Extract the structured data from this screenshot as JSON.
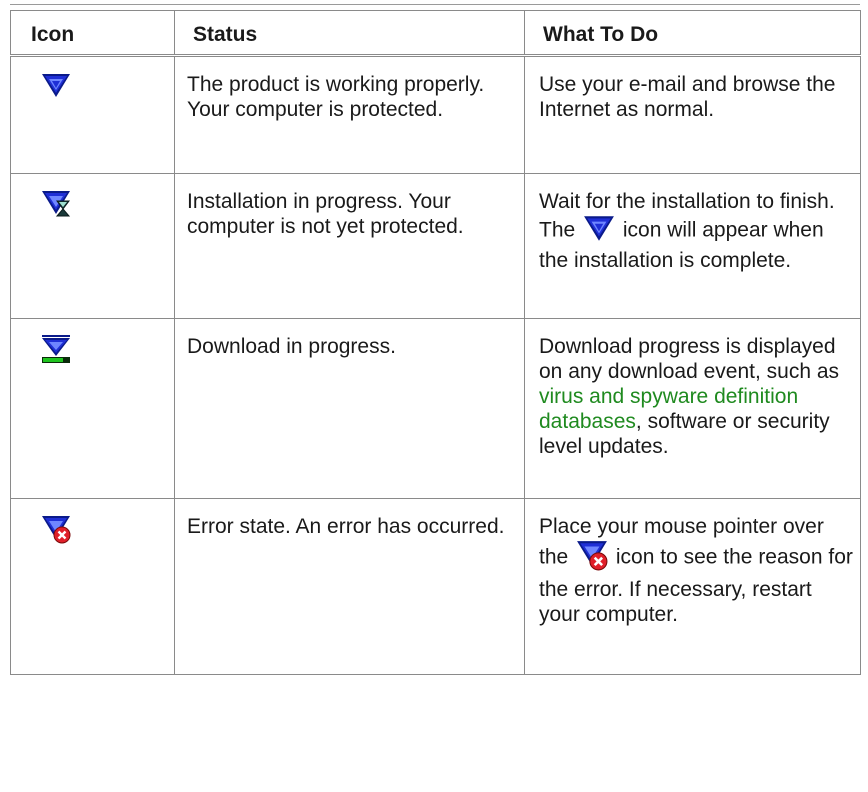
{
  "table": {
    "headers": {
      "icon": "Icon",
      "status": "Status",
      "todo": "What To Do"
    },
    "rows": [
      {
        "icon": "shield-ok-icon",
        "status": "The product is working properly. Your computer is protected.",
        "todo": "Use your e-mail and browse the Internet as normal."
      },
      {
        "icon": "shield-installing-icon",
        "status": "Installation in progress. Your computer is not yet protected.",
        "todo_before": "Wait for the installation to finish. The",
        "todo_icon": "shield-ok-icon",
        "todo_after": "icon will appear when the installation is complete."
      },
      {
        "icon": "shield-downloading-icon",
        "status": "Download in progress.",
        "todo_before": "Download progress is displayed on any download event, such as",
        "todo_link": "virus and spyware definition databases",
        "todo_after": ", software or security level updates."
      },
      {
        "icon": "shield-error-icon",
        "status": "Error state. An error has occurred.",
        "todo_before": "Place your mouse pointer over the",
        "todo_icon": "shield-error-icon",
        "todo_after": "icon to see the reason for the error. If necessary, restart your computer."
      }
    ]
  },
  "colors": {
    "shield_blue": "#1f2fd6",
    "shield_dark": "#0a1a8a",
    "link_green": "#1f8a1f",
    "error_red": "#e0202a",
    "progress_green": "#1fc41f",
    "border_gray": "#8a8a8a"
  }
}
